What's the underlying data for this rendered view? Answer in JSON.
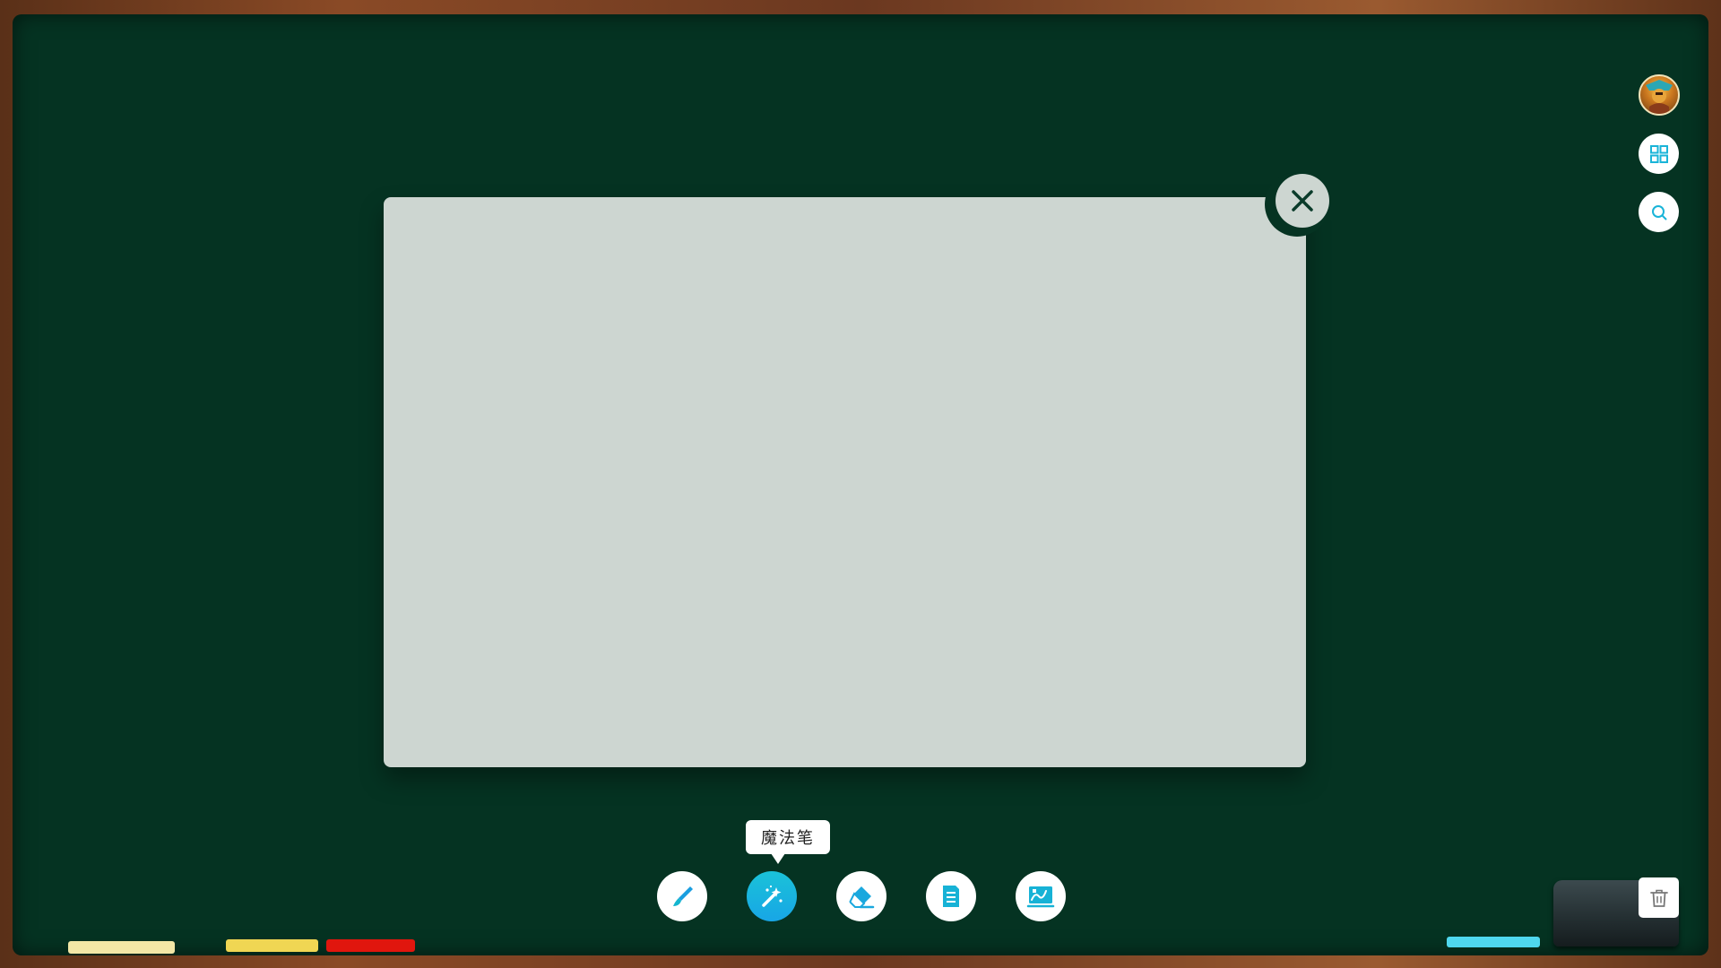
{
  "tooltip": {
    "label": "魔法笔"
  },
  "colors": {
    "board": "#053322",
    "canvas": "#cdd6d1",
    "accent": "#1ab0e0",
    "chalk_white": "#f2e7a6",
    "chalk_yellow": "#f0d653",
    "chalk_red": "#e0160e",
    "chalk_blue": "#4fd7ee"
  },
  "toolbar": {
    "tools": [
      {
        "icon": "brush-icon",
        "tooltip": ""
      },
      {
        "icon": "magic-wand-icon",
        "tooltip": "魔法笔",
        "active": true
      },
      {
        "icon": "eraser-icon",
        "tooltip": ""
      },
      {
        "icon": "notes-icon",
        "tooltip": ""
      },
      {
        "icon": "image-draw-icon",
        "tooltip": ""
      }
    ]
  },
  "side_panel": {
    "icons": [
      "avatar",
      "grid-icon",
      "search-icon"
    ]
  }
}
